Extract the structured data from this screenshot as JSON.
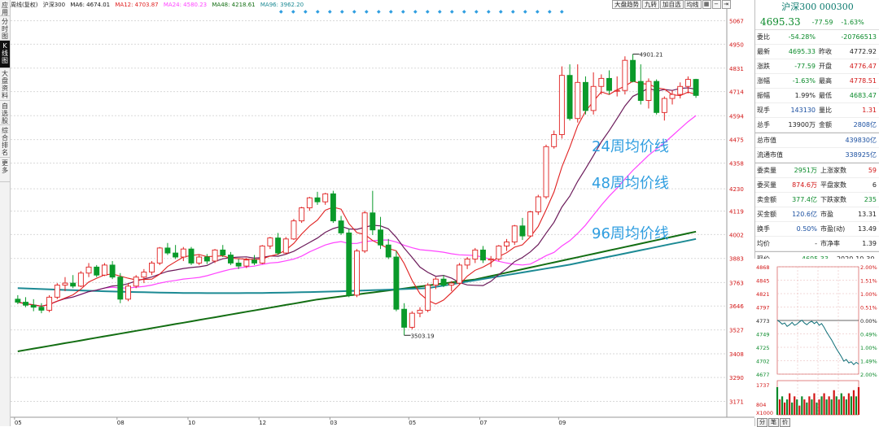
{
  "left_tabs": [
    {
      "label": "应用",
      "active": false
    },
    {
      "label": "分时图",
      "active": false
    },
    {
      "label": "K线图",
      "active": true
    },
    {
      "label": "大盘资料",
      "active": false
    },
    {
      "label": "自选股",
      "active": false
    },
    {
      "label": "综合排名",
      "active": false
    },
    {
      "label": "更多",
      "active": false
    }
  ],
  "legend": {
    "prefix": "周线(复权)",
    "name": "沪深300",
    "ma6": "MA6: 4674.01",
    "ma12": "MA12: 4703.87",
    "ma24": "MA24: 4580.23",
    "ma48": "MA48: 4218.61",
    "ma96": "MA96: 3962.20"
  },
  "toolbar": {
    "items": [
      "大盘趋势",
      "九转",
      "加自选",
      "均线",
      "",
      ""
    ],
    "icons": [
      "grid-icon",
      "minus-icon",
      "arrow-right-icon"
    ]
  },
  "y_axis": [
    "5067",
    "4950",
    "4831",
    "4714",
    "4594",
    "4475",
    "4358",
    "4230",
    "4119",
    "4002",
    "3883",
    "3763",
    "3646",
    "3527",
    "3408",
    "3290",
    "3171"
  ],
  "x_axis": [
    "05",
    "08",
    "10",
    "12",
    "03",
    "05",
    "07",
    "09"
  ],
  "annotations": {
    "high": "4901.21",
    "low": "3503.19",
    "ma24_label": "24周均价线",
    "ma48_label": "48周均价线",
    "ma96_label": "96周均价线"
  },
  "colors": {
    "up": "#e02020",
    "down": "#0a9a2a",
    "ma6": "#111111",
    "ma12": "#e02020",
    "ma24": "#ff44ff",
    "ma48": "#136e13",
    "ma96": "#1c8a94",
    "label_blue": "#2f9ee0"
  },
  "chart_data": {
    "type": "candlestick",
    "title": "",
    "ylim": [
      3100,
      5100
    ],
    "weeks": 92,
    "ohlc": [
      [
        3680,
        3700,
        3655,
        3665
      ],
      [
        3665,
        3690,
        3640,
        3650
      ],
      [
        3650,
        3680,
        3620,
        3640
      ],
      [
        3640,
        3660,
        3610,
        3625
      ],
      [
        3625,
        3700,
        3615,
        3690
      ],
      [
        3690,
        3760,
        3680,
        3750
      ],
      [
        3750,
        3790,
        3720,
        3760
      ],
      [
        3760,
        3800,
        3735,
        3745
      ],
      [
        3745,
        3820,
        3740,
        3810
      ],
      [
        3810,
        3860,
        3790,
        3840
      ],
      [
        3840,
        3850,
        3790,
        3800
      ],
      [
        3800,
        3860,
        3795,
        3850
      ],
      [
        3850,
        3870,
        3780,
        3790
      ],
      [
        3790,
        3810,
        3660,
        3680
      ],
      [
        3680,
        3760,
        3670,
        3745
      ],
      [
        3745,
        3800,
        3735,
        3790
      ],
      [
        3790,
        3830,
        3760,
        3815
      ],
      [
        3815,
        3870,
        3800,
        3860
      ],
      [
        3860,
        3940,
        3850,
        3935
      ],
      [
        3935,
        3960,
        3900,
        3910
      ],
      [
        3910,
        3950,
        3880,
        3890
      ],
      [
        3890,
        3940,
        3870,
        3930
      ],
      [
        3930,
        3940,
        3850,
        3860
      ],
      [
        3860,
        3900,
        3850,
        3890
      ],
      [
        3890,
        3905,
        3855,
        3870
      ],
      [
        3870,
        3930,
        3860,
        3925
      ],
      [
        3925,
        3950,
        3890,
        3900
      ],
      [
        3900,
        3915,
        3850,
        3860
      ],
      [
        3860,
        3880,
        3830,
        3845
      ],
      [
        3845,
        3885,
        3835,
        3875
      ],
      [
        3875,
        3900,
        3850,
        3860
      ],
      [
        3860,
        3950,
        3855,
        3945
      ],
      [
        3945,
        3990,
        3930,
        3985
      ],
      [
        3985,
        4010,
        3900,
        3910
      ],
      [
        3910,
        3990,
        3905,
        3980
      ],
      [
        3980,
        4080,
        3975,
        4070
      ],
      [
        4070,
        4140,
        4060,
        4135
      ],
      [
        4135,
        4190,
        4120,
        4185
      ],
      [
        4185,
        4215,
        4150,
        4165
      ],
      [
        4165,
        4210,
        4150,
        4205
      ],
      [
        4205,
        4220,
        4060,
        4070
      ],
      [
        4070,
        4095,
        4000,
        4010
      ],
      [
        4010,
        4030,
        3690,
        3700
      ],
      [
        3700,
        3930,
        3690,
        3920
      ],
      [
        3920,
        4120,
        3910,
        4110
      ],
      [
        4110,
        4220,
        4000,
        4025
      ],
      [
        4025,
        4090,
        3930,
        3950
      ],
      [
        3950,
        3980,
        3880,
        3890
      ],
      [
        3890,
        3920,
        3620,
        3630
      ],
      [
        3630,
        3660,
        3500,
        3540
      ],
      [
        3540,
        3620,
        3530,
        3610
      ],
      [
        3610,
        3640,
        3590,
        3625
      ],
      [
        3625,
        3760,
        3615,
        3750
      ],
      [
        3750,
        3790,
        3730,
        3780
      ],
      [
        3780,
        3800,
        3740,
        3750
      ],
      [
        3750,
        3770,
        3720,
        3760
      ],
      [
        3760,
        3860,
        3750,
        3850
      ],
      [
        3850,
        3890,
        3830,
        3880
      ],
      [
        3880,
        3935,
        3860,
        3925
      ],
      [
        3925,
        3945,
        3860,
        3875
      ],
      [
        3875,
        3895,
        3840,
        3880
      ],
      [
        3880,
        3950,
        3870,
        3945
      ],
      [
        3945,
        3980,
        3920,
        3965
      ],
      [
        3965,
        4050,
        3950,
        4045
      ],
      [
        4045,
        4085,
        3975,
        3995
      ],
      [
        3995,
        4120,
        3990,
        4115
      ],
      [
        4115,
        4200,
        4100,
        4190
      ],
      [
        4190,
        4450,
        4180,
        4440
      ],
      [
        4440,
        4520,
        4430,
        4500
      ],
      [
        4500,
        4840,
        4480,
        4795
      ],
      [
        4795,
        4850,
        4570,
        4580
      ],
      [
        4580,
        4850,
        4560,
        4760
      ],
      [
        4760,
        4790,
        4600,
        4620
      ],
      [
        4620,
        4810,
        4600,
        4740
      ],
      [
        4740,
        4800,
        4700,
        4780
      ],
      [
        4780,
        4820,
        4700,
        4720
      ],
      [
        4720,
        4790,
        4690,
        4720
      ],
      [
        4720,
        4890,
        4700,
        4870
      ],
      [
        4870,
        4901,
        4760,
        4765
      ],
      [
        4765,
        4850,
        4650,
        4670
      ],
      [
        4670,
        4780,
        4630,
        4765
      ],
      [
        4765,
        4775,
        4600,
        4610
      ],
      [
        4610,
        4690,
        4570,
        4680
      ],
      [
        4680,
        4720,
        4650,
        4700
      ],
      [
        4700,
        4760,
        4680,
        4740
      ],
      [
        4740,
        4790,
        4705,
        4775
      ],
      [
        4775,
        4778,
        4683,
        4695
      ]
    ]
  },
  "panel": {
    "title": "沪深300 000300",
    "price": "4695.33",
    "change": "-77.59",
    "pct": "-1.63%",
    "rows1": [
      {
        "l": "委比",
        "v1": "-54.28%",
        "v2": "-20766513",
        "c1": "g",
        "c2": "g"
      },
      {
        "l": "最新",
        "v1": "4695.33",
        "l2": "昨收",
        "v2": "4772.92",
        "c1": "g",
        "c2": "k"
      },
      {
        "l": "涨跌",
        "v1": "-77.59",
        "l2": "开盘",
        "v2": "4776.47",
        "c1": "g",
        "c2": "r"
      },
      {
        "l": "涨幅",
        "v1": "-1.63%",
        "l2": "最高",
        "v2": "4778.51",
        "c1": "g",
        "c2": "r"
      },
      {
        "l": "振幅",
        "v1": "1.99%",
        "l2": "最低",
        "v2": "4683.47",
        "c1": "k",
        "c2": "g"
      },
      {
        "l": "现手",
        "v1": "143130",
        "l2": "量比",
        "v2": "1.31",
        "c1": "b",
        "c2": "r"
      },
      {
        "l": "总手",
        "v1": "13900万",
        "l2": "金额",
        "v2": "2808亿",
        "c1": "k",
        "c2": "b"
      }
    ],
    "rows2": [
      {
        "l": "总市值",
        "v": "439830亿"
      },
      {
        "l": "流通市值",
        "v": "338925亿"
      }
    ],
    "rows3": [
      {
        "l": "委卖量",
        "v1": "2951万",
        "l2": "上涨家数",
        "v2": "59",
        "c1": "g",
        "c2": "r"
      },
      {
        "l": "委买量",
        "v1": "874.6万",
        "l2": "平盘家数",
        "v2": "6",
        "c1": "r",
        "c2": "k"
      },
      {
        "l": "卖金额",
        "v1": "377.4亿",
        "l2": "下跌家数",
        "v2": "235",
        "c1": "g",
        "c2": "g"
      },
      {
        "l": "买金额",
        "v1": "120.6亿",
        "l2": "市盈",
        "v2": "13.31",
        "c1": "b",
        "c2": "k"
      },
      {
        "l": "换手",
        "v1": "0.50%",
        "l2": "市盈(动)",
        "v2": "13.49",
        "c1": "b",
        "c2": "k"
      },
      {
        "l": "均价",
        "v1": "-",
        "l2": "市净率",
        "v2": "1.39",
        "c1": "k",
        "c2": "k"
      }
    ],
    "now_label": "现价",
    "now_value": "4695.33",
    "date": "2020-10-30,五"
  },
  "mini": {
    "left_axis": [
      "4868",
      "4845",
      "4821",
      "4797",
      "4773",
      "4749",
      "4725",
      "4702",
      "4677"
    ],
    "right_axis": [
      "2.00%",
      "1.51%",
      "1.00%",
      "0.51%",
      "0.00%",
      "0.49%",
      "1.00%",
      "1.49%",
      "2.00%"
    ],
    "vol_axis": [
      "1737",
      "804",
      "X1000"
    ],
    "base": 4773,
    "series": [
      4773,
      4770,
      4766,
      4768,
      4762,
      4765,
      4769,
      4764,
      4766,
      4770,
      4773,
      4768,
      4765,
      4769,
      4771,
      4767,
      4770,
      4764,
      4767,
      4760,
      4752,
      4745,
      4738,
      4730,
      4722,
      4715,
      4708,
      4700,
      4703,
      4697,
      4699,
      4694,
      4698,
      4695
    ],
    "volumes": [
      0.9,
      0.5,
      0.6,
      0.4,
      0.5,
      0.7,
      0.4,
      0.6,
      0.5,
      0.3,
      0.6,
      0.5,
      0.4,
      0.6,
      0.5,
      0.7,
      0.4,
      0.5,
      0.6,
      0.7,
      0.5,
      0.6,
      0.5,
      0.8,
      0.6,
      0.5,
      0.7,
      0.6,
      0.5,
      0.7,
      0.6,
      0.8,
      0.6,
      0.9
    ]
  },
  "bottom_tabs": [
    "分",
    "笔",
    "价"
  ]
}
